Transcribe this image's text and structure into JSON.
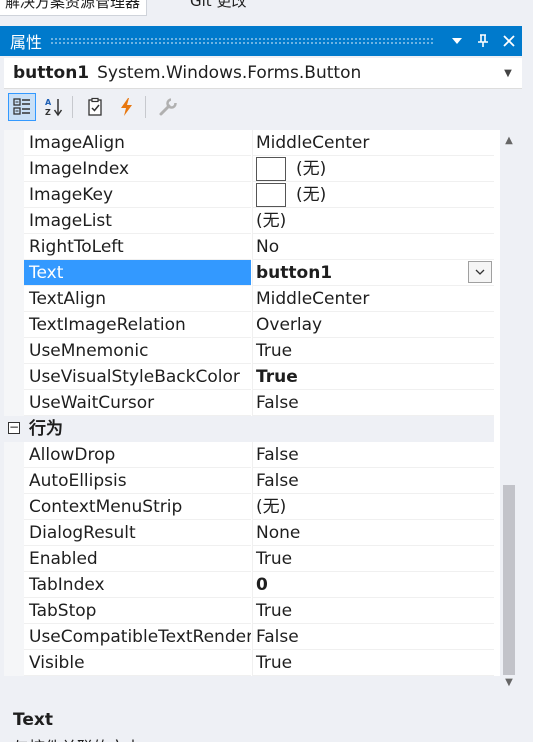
{
  "top_tabs": {
    "solution_explorer": "解决方案资源管理器",
    "git_changes": "Git 更改"
  },
  "panel": {
    "title": "属性",
    "buttons": {
      "dropdown": "▼",
      "pin": "⊥",
      "close": "✕"
    }
  },
  "object_selector": {
    "name": "button1",
    "type": "System.Windows.Forms.Button"
  },
  "toolbar": {
    "tools": [
      "categorized-icon",
      "alphabetical-icon",
      "properties-icon",
      "events-icon",
      "property-pages-icon"
    ]
  },
  "grid": {
    "rows": [
      {
        "name": "ImageAlign",
        "value": "MiddleCenter"
      },
      {
        "name": "ImageIndex",
        "value": "(无)",
        "swatch": true
      },
      {
        "name": "ImageKey",
        "value": "(无)",
        "swatch": true
      },
      {
        "name": "ImageList",
        "value": "(无)"
      },
      {
        "name": "RightToLeft",
        "value": "No"
      },
      {
        "name": "Text",
        "value": "button1",
        "selected": true
      },
      {
        "name": "TextAlign",
        "value": "MiddleCenter"
      },
      {
        "name": "TextImageRelation",
        "value": "Overlay"
      },
      {
        "name": "UseMnemonic",
        "value": "True"
      },
      {
        "name": "UseVisualStyleBackColor",
        "value": "True",
        "bold": true
      },
      {
        "name": "UseWaitCursor",
        "value": "False"
      }
    ],
    "category": {
      "label": "行为",
      "toggle": "−"
    },
    "category_rows": [
      {
        "name": "AllowDrop",
        "value": "False"
      },
      {
        "name": "AutoEllipsis",
        "value": "False"
      },
      {
        "name": "ContextMenuStrip",
        "value": "(无)"
      },
      {
        "name": "DialogResult",
        "value": "None"
      },
      {
        "name": "Enabled",
        "value": "True"
      },
      {
        "name": "TabIndex",
        "value": "0",
        "bold": true
      },
      {
        "name": "TabStop",
        "value": "True"
      },
      {
        "name": "UseCompatibleTextRendering",
        "value": "False"
      },
      {
        "name": "Visible",
        "value": "True"
      }
    ]
  },
  "description": {
    "title": "Text",
    "text": "与控件关联的文本。"
  },
  "colors": {
    "accent": "#007acc",
    "selection": "#3399ff"
  }
}
